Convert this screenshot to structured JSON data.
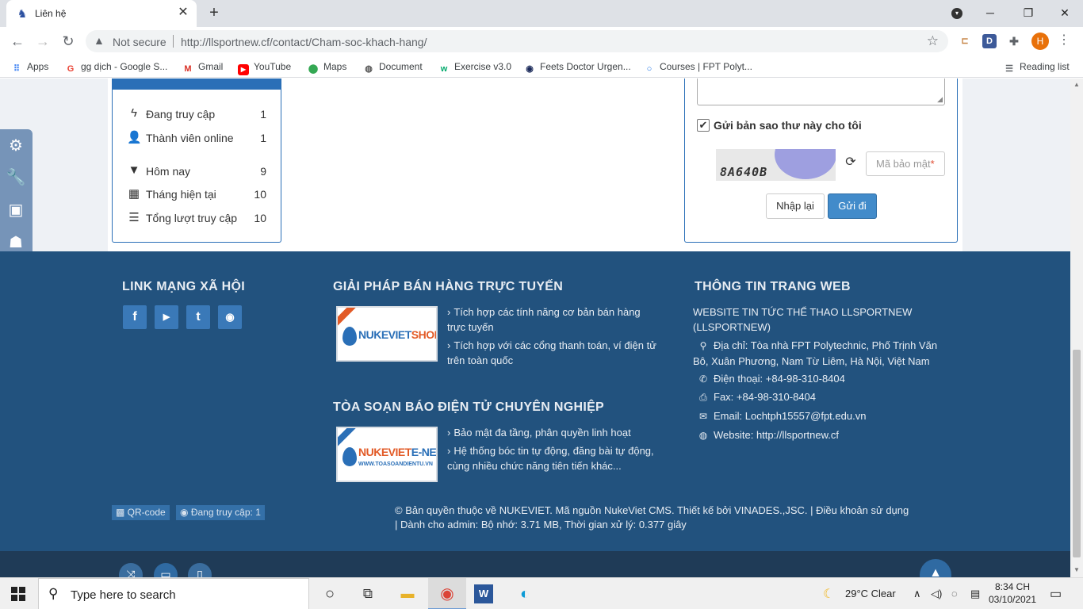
{
  "browser": {
    "tab_title": "Liên hệ",
    "tab_close": "✕",
    "new_tab": "+",
    "url_warning": "Not secure",
    "url": "http://llsportnew.cf/contact/Cham-soc-khach-hang/",
    "profile_initial": "H",
    "window_controls": [
      "─",
      "❐",
      "✕"
    ],
    "bookmarks": [
      {
        "label": "Apps",
        "icon": "apps-grid-icon"
      },
      {
        "label": "gg dịch - Google S...",
        "icon": "google-icon"
      },
      {
        "label": "Gmail",
        "icon": "gmail-icon"
      },
      {
        "label": "YouTube",
        "icon": "youtube-icon"
      },
      {
        "label": "Maps",
        "icon": "maps-icon"
      },
      {
        "label": "Document",
        "icon": "globe-icon"
      },
      {
        "label": "Exercise v3.0",
        "icon": "w3-icon"
      },
      {
        "label": "Feets Doctor Urgen...",
        "icon": "feets-icon"
      },
      {
        "label": "Courses | FPT Polyt...",
        "icon": "courses-icon"
      }
    ],
    "reading_list": "Reading list"
  },
  "stats": {
    "items": [
      {
        "label": "Đang truy cập",
        "value": "1",
        "icon": "bolt-icon"
      },
      {
        "label": "Thành viên online",
        "value": "1",
        "icon": "user-icon"
      },
      {
        "label": "Hôm nay",
        "value": "9",
        "icon": "filter-icon"
      },
      {
        "label": "Tháng hiện tại",
        "value": "10",
        "icon": "calendar-icon"
      },
      {
        "label": "Tổng lượt truy cập",
        "value": "10",
        "icon": "list-icon"
      }
    ]
  },
  "contact_form": {
    "send_copy_label": "Gửi bản sao thư này cho tôi",
    "send_copy_checked": true,
    "captcha_text": "8A640B",
    "captcha_placeholder": "Mã bảo mật",
    "captcha_required_mark": "*",
    "reset_label": "Nhập lại",
    "submit_label": "Gửi đi"
  },
  "footer": {
    "social": {
      "heading": "LINK MẠNG XÃ HỘI",
      "links": [
        {
          "name": "facebook",
          "glyph": "f"
        },
        {
          "name": "youtube",
          "glyph": "▶"
        },
        {
          "name": "twitter",
          "glyph": "t"
        },
        {
          "name": "rss",
          "glyph": "◉"
        }
      ]
    },
    "shop": {
      "heading": "GIẢI PHÁP BÁN HÀNG TRỰC TUYẾN",
      "brand_main": "NUKEVIET",
      "brand_accent": "SHOP",
      "items": [
        "Tích hợp các tính năng cơ bản bán hàng trực tuyến",
        "Tích hợp với các cổng thanh toán, ví điện tử trên toàn quốc"
      ]
    },
    "news": {
      "heading": "TÒA SOẠN BÁO ĐIỆN TỬ CHUYÊN NGHIỆP",
      "brand_main": "NUKEVIET",
      "brand_accent": "E-NEWS",
      "brand_sub": "WWW.TOASOANDIENTU.VN",
      "items": [
        "Bảo mật đa tầng, phân quyền linh hoạt",
        "Hệ thống bóc tin tự động, đăng bài tự động, cùng nhiều chức năng tiên tiến khác..."
      ]
    },
    "info": {
      "heading": "THÔNG TIN TRANG WEB",
      "site_name": "WEBSITE TIN TỨC THỂ THAO LLSPORTNEW (LLSPORTNEW)",
      "address": "Địa chỉ: Tòa nhà FPT Polytechnic, Phố Trịnh Văn Bô, Xuân Phương, Nam Từ Liêm, Hà Nội, Việt Nam",
      "phone": "Điện thoại: +84-98-310-8404",
      "fax": "Fax: +84-98-310-8404",
      "email": "Email: Lochtph15557@fpt.edu.vn",
      "website": "Website: http://llsportnew.cf"
    },
    "qr_label": "QR-code",
    "online_label": "Đang truy cập: 1",
    "copyright": "© Bản quyền thuộc về NUKEVIET.  Mã nguồn NukeViet CMS.  Thiết kế bởi VINADES.,JSC.   |  Điều khoản sử dụng",
    "admin_stats": " |  Dành cho admin: Bộ nhớ: 3.71 MB, Thời gian xử lý: 0.377 giây"
  },
  "taskbar": {
    "search_placeholder": "Type here to search",
    "weather": "29°C  Clear",
    "time": "8:34 CH",
    "date": "03/10/2021"
  }
}
